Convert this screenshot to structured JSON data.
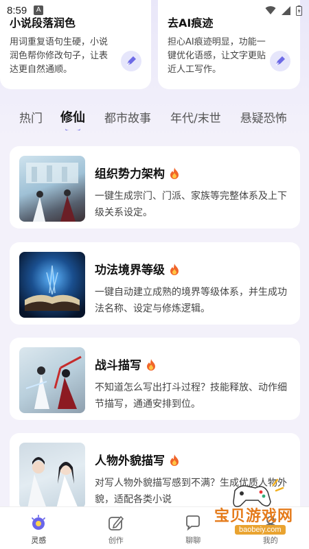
{
  "status": {
    "time": "8:59",
    "notif_letter": "A"
  },
  "top_cards": [
    {
      "title": "小说段落润色",
      "desc": "用词重复语句生硬，小说润色帮你修改句子，让表达更自然通顺。"
    },
    {
      "title": "去AI痕迹",
      "desc": "担心AI痕迹明显，功能一键优化语感，让文字更贴近人工写作。"
    }
  ],
  "tabs": [
    "热门",
    "修仙",
    "都市故事",
    "年代/末世",
    "悬疑恐怖"
  ],
  "active_tab": "修仙",
  "cards": [
    {
      "title": "组织势力架构",
      "desc": "一键生成宗门、门派、家族等完整体系及上下级关系设定。"
    },
    {
      "title": "功法境界等级",
      "desc": "一键自动建立成熟的境界等级体系，并生成功法名称、设定与修炼逻辑。"
    },
    {
      "title": "战斗描写",
      "desc": "不知道怎么写出打斗过程？技能释放、动作细节描写，通通安排到位。"
    },
    {
      "title": "人物外貌描写",
      "desc": "对写人物外貌描写感到不满？生成优质人物外貌，适配各类小说"
    }
  ],
  "nav": [
    "灵感",
    "创作",
    "聊聊",
    "我的"
  ],
  "watermark": {
    "text": "宝贝游戏网",
    "url": "baobeiy.com"
  },
  "colors": {
    "accent": "#5a57e0",
    "background": "#f3f1fa",
    "fire": "#f0652a"
  }
}
